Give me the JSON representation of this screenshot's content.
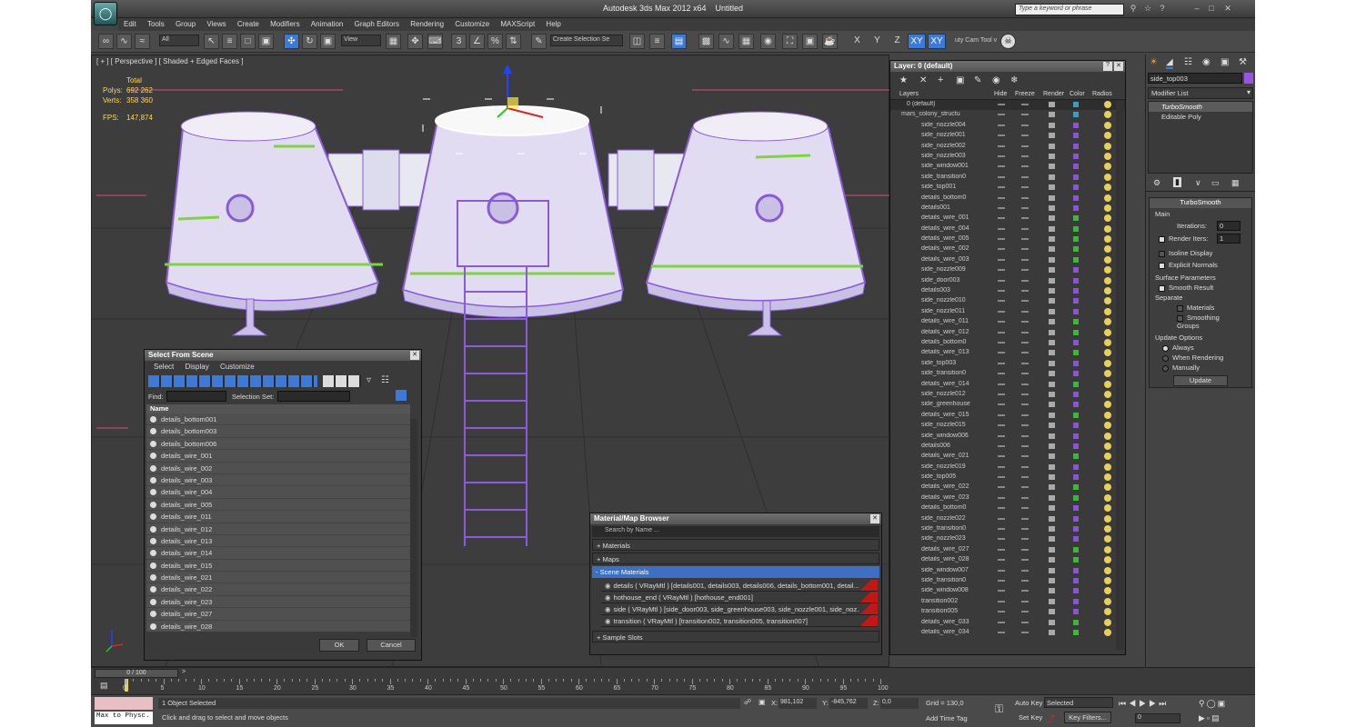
{
  "app": {
    "title": "Autodesk 3ds Max  2012 x64",
    "doc": "Untitled",
    "search_placeholder": "Type a keyword or phrase"
  },
  "menu": [
    "Edit",
    "Tools",
    "Group",
    "Views",
    "Create",
    "Modifiers",
    "Animation",
    "Graph Editors",
    "Rendering",
    "Customize",
    "MAXScript",
    "Help"
  ],
  "toolbar": {
    "filter": "All",
    "refcoord": "View",
    "selset": "Create Selection Se",
    "axes": [
      "X",
      "Y",
      "Z",
      "XY",
      "XY"
    ],
    "script": "uty Cam Tool v"
  },
  "viewport": {
    "label": "[ + ] [ Perspective ] [ Shaded + Edged Faces ]",
    "stats": {
      "total": "Total",
      "polys_label": "Polys:",
      "polys": "692 262",
      "verts_label": "Verts:",
      "verts": "358 360",
      "fps_label": "FPS:",
      "fps": "147,874"
    }
  },
  "layer_panel": {
    "title": "Layer: 0 (default)",
    "columns": [
      "Layers",
      "Hide",
      "Freeze",
      "Render",
      "Color",
      "Radios"
    ],
    "rows": [
      {
        "name": "0 (default)",
        "color": "#37a0c0"
      },
      {
        "name": "mars_colony_structu",
        "color": "#37a0c0"
      },
      {
        "name": "side_nozzle004",
        "color": "#8a55d0"
      },
      {
        "name": "side_nozzle001",
        "color": "#8a55d0"
      },
      {
        "name": "side_nozzle002",
        "color": "#8a55d0"
      },
      {
        "name": "side_nozzle003",
        "color": "#8a55d0"
      },
      {
        "name": "side_window001",
        "color": "#8a55d0"
      },
      {
        "name": "side_transition0",
        "color": "#8a55d0"
      },
      {
        "name": "side_top001",
        "color": "#8a55d0"
      },
      {
        "name": "details_bottom0",
        "color": "#8a55d0"
      },
      {
        "name": "details001",
        "color": "#8a55d0"
      },
      {
        "name": "details_wire_001",
        "color": "#39b83a"
      },
      {
        "name": "details_wire_004",
        "color": "#39b83a"
      },
      {
        "name": "details_wire_005",
        "color": "#39b83a"
      },
      {
        "name": "details_wire_002",
        "color": "#39b83a"
      },
      {
        "name": "details_wire_003",
        "color": "#39b83a"
      },
      {
        "name": "side_nozzle009",
        "color": "#8a55d0"
      },
      {
        "name": "side_door003",
        "color": "#8a55d0"
      },
      {
        "name": "details003",
        "color": "#8a55d0"
      },
      {
        "name": "side_nozzle010",
        "color": "#8a55d0"
      },
      {
        "name": "side_nozzle011",
        "color": "#8a55d0"
      },
      {
        "name": "details_wire_011",
        "color": "#39b83a"
      },
      {
        "name": "details_wire_012",
        "color": "#39b83a"
      },
      {
        "name": "details_bottom0",
        "color": "#8a55d0"
      },
      {
        "name": "details_wire_013",
        "color": "#39b83a"
      },
      {
        "name": "side_top003",
        "color": "#8a55d0"
      },
      {
        "name": "side_transition0",
        "color": "#8a55d0"
      },
      {
        "name": "details_wire_014",
        "color": "#39b83a"
      },
      {
        "name": "side_nozzle012",
        "color": "#8a55d0"
      },
      {
        "name": "side_greenhouse",
        "color": "#8a55d0"
      },
      {
        "name": "details_wire_015",
        "color": "#39b83a"
      },
      {
        "name": "side_nozzle015",
        "color": "#8a55d0"
      },
      {
        "name": "side_window006",
        "color": "#8a55d0"
      },
      {
        "name": "details006",
        "color": "#8a55d0"
      },
      {
        "name": "details_wire_021",
        "color": "#39b83a"
      },
      {
        "name": "side_nozzle019",
        "color": "#8a55d0"
      },
      {
        "name": "side_top005",
        "color": "#8a55d0"
      },
      {
        "name": "details_wire_022",
        "color": "#39b83a"
      },
      {
        "name": "details_wire_023",
        "color": "#39b83a"
      },
      {
        "name": "details_bottom0",
        "color": "#8a55d0"
      },
      {
        "name": "side_nozzle022",
        "color": "#8a55d0"
      },
      {
        "name": "side_transition0",
        "color": "#8a55d0"
      },
      {
        "name": "side_nozzle023",
        "color": "#8a55d0"
      },
      {
        "name": "details_wire_027",
        "color": "#39b83a"
      },
      {
        "name": "details_wire_028",
        "color": "#39b83a"
      },
      {
        "name": "side_window007",
        "color": "#8a55d0"
      },
      {
        "name": "side_transition0",
        "color": "#8a55d0"
      },
      {
        "name": "side_window008",
        "color": "#8a55d0"
      },
      {
        "name": "transition002",
        "color": "#8a55d0"
      },
      {
        "name": "transition005",
        "color": "#8a55d0"
      },
      {
        "name": "details_wire_033",
        "color": "#39b83a"
      },
      {
        "name": "details_wire_034",
        "color": "#39b83a"
      }
    ]
  },
  "select_from_scene": {
    "title": "Select From Scene",
    "menus": [
      "Select",
      "Display",
      "Customize"
    ],
    "find_label": "Find:",
    "selset_label": "Selection Set:",
    "column": "Name",
    "items": [
      "details_bottom001",
      "details_bottom003",
      "details_bottom006",
      "details_wire_001",
      "details_wire_002",
      "details_wire_003",
      "details_wire_004",
      "details_wire_005",
      "details_wire_011",
      "details_wire_012",
      "details_wire_013",
      "details_wire_014",
      "details_wire_015",
      "details_wire_021",
      "details_wire_022",
      "details_wire_023",
      "details_wire_027",
      "details_wire_028"
    ],
    "ok": "OK",
    "cancel": "Cancel"
  },
  "material_browser": {
    "title": "Material/Map Browser",
    "search": "Search by Name ...",
    "sections": {
      "materials": "+ Materials",
      "maps": "+ Maps",
      "scene": "- Scene Materials",
      "sample": "+ Sample Slots"
    },
    "scene_materials": [
      "details  ( VRayMtl )  [details001, details003, details006, details_bottom001, detail...",
      "hothouse_end  ( VRayMtl )  [hothouse_end001]",
      "side  ( VRayMtl )  [side_door003, side_greenhouse003, side_nozzle001, side_noz...",
      "transition  ( VRayMtl )  [transition002, transition005, transition007]"
    ]
  },
  "command_panel": {
    "object_name": "side_top003",
    "modifier_list": "Modifier List",
    "stack": [
      "TurboSmooth",
      "Editable Poly"
    ],
    "rollout": "TurboSmooth",
    "main": "Main",
    "iterations_label": "Iterations:",
    "iterations": "0",
    "render_iters_label": "Render Iters:",
    "render_iters": "1",
    "isoline": "Isoline Display",
    "explicit": "Explicit Normals",
    "surface_params": "Surface Parameters",
    "smooth_result": "Smooth Result",
    "separate": "Separate",
    "materials": "Materials",
    "smoothing_groups": "Smoothing Groups",
    "update_options": "Update Options",
    "always": "Always",
    "when_rendering": "When Rendering",
    "manually": "Manually",
    "update": "Update"
  },
  "timeline": {
    "frame": "0 / 100",
    "ticks": [
      "0",
      "5",
      "10",
      "15",
      "20",
      "25",
      "30",
      "35",
      "40",
      "45",
      "50",
      "55",
      "60",
      "65",
      "70",
      "75",
      "80",
      "85",
      "90",
      "95",
      "100"
    ]
  },
  "status": {
    "maxscript": "Max to Physc.",
    "selected": "1 Object Selected",
    "prompt": "Click and drag to select and move objects",
    "x_label": "X:",
    "x": "981,102",
    "y_label": "Y:",
    "y": "-845,762",
    "z_label": "Z:",
    "z": "0,0",
    "grid": "Grid = 130,0",
    "add_time_tag": "Add Time Tag",
    "auto_key": "Auto Key",
    "set_key": "Set Key",
    "key_mode": "Selected",
    "key_filters": "Key Filters...",
    "frame": "0"
  }
}
